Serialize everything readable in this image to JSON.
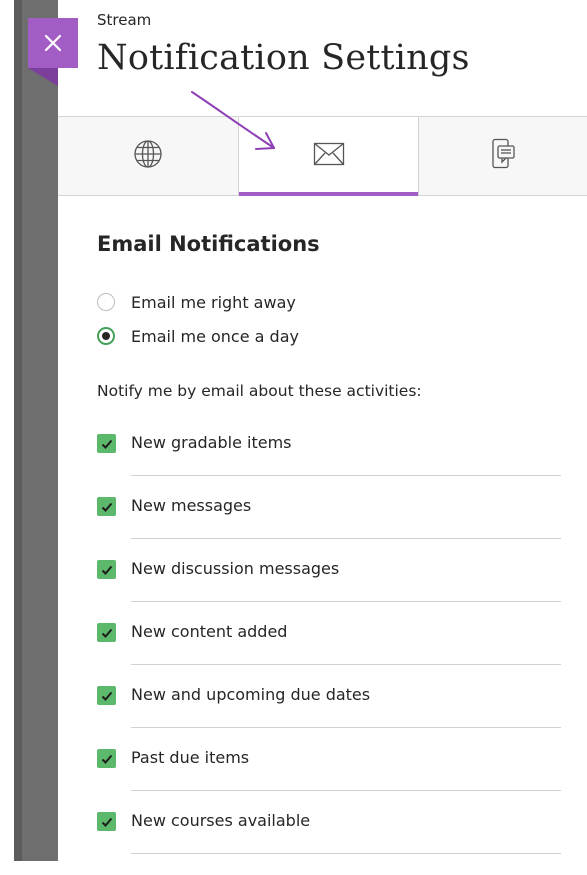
{
  "header": {
    "kicker": "Stream",
    "title": "Notification Settings"
  },
  "close_button": {
    "icon": "close-icon",
    "color": "#a25dc4"
  },
  "tabs": [
    {
      "name": "web",
      "icon": "globe-icon",
      "selected": false
    },
    {
      "name": "email",
      "icon": "envelope-icon",
      "selected": true
    },
    {
      "name": "push",
      "icon": "mobile-message-icon",
      "selected": false
    }
  ],
  "email": {
    "heading": "Email Notifications",
    "frequency_options": [
      {
        "label": "Email me right away",
        "selected": false
      },
      {
        "label": "Email me once a day",
        "selected": true
      }
    ],
    "activities_label": "Notify me by email about these activities:",
    "activities": [
      {
        "label": "New gradable items",
        "checked": true
      },
      {
        "label": "New messages",
        "checked": true
      },
      {
        "label": "New discussion messages",
        "checked": true
      },
      {
        "label": "New content added",
        "checked": true
      },
      {
        "label": "New and upcoming due dates",
        "checked": true
      },
      {
        "label": "Past due items",
        "checked": true
      },
      {
        "label": "New courses available",
        "checked": true
      }
    ]
  },
  "colors": {
    "accent": "#a25dc4",
    "check_green": "#5cb86a",
    "annotation_arrow": "#8e3fb5"
  }
}
